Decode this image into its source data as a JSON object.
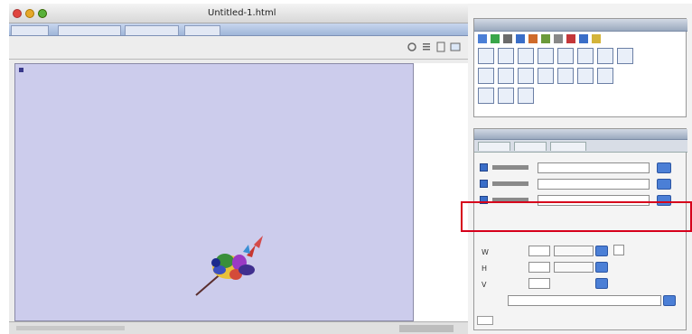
{
  "window": {
    "title": "Untitled-1.html"
  },
  "highlight": {
    "rows": [
      {
        "name": "",
        "value": ""
      },
      {
        "name": "",
        "value": ""
      }
    ]
  },
  "dimensions": {
    "rows": [
      {
        "label": "W",
        "value": ""
      },
      {
        "label": "H",
        "value": ""
      },
      {
        "label": "V",
        "value": ""
      }
    ]
  },
  "class_field": {
    "label": "",
    "value": ""
  },
  "colors": {
    "canvas_bg": "#ccccec",
    "highlight": "#d6001b",
    "accent": "#4b7fd6"
  }
}
